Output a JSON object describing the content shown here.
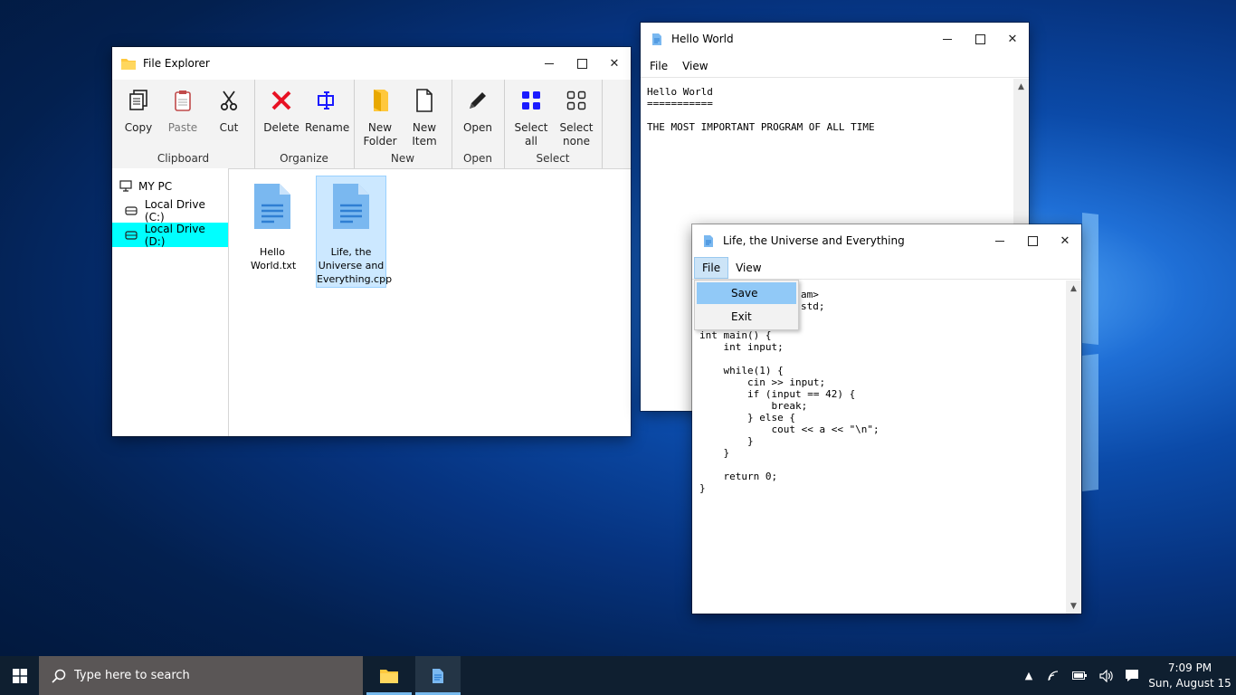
{
  "file_explorer": {
    "title": "File Explorer",
    "ribbon": {
      "groups": [
        {
          "label": "Clipboard",
          "buttons": [
            "Copy",
            "Paste",
            "Cut"
          ]
        },
        {
          "label": "Organize",
          "buttons": [
            "Delete",
            "Rename"
          ]
        },
        {
          "label": "New",
          "buttons": [
            "New Folder",
            "New Item"
          ]
        },
        {
          "label": "Open",
          "buttons": [
            "Open"
          ]
        },
        {
          "label": "Select",
          "buttons": [
            "Select all",
            "Select none"
          ]
        }
      ]
    },
    "nav": [
      "MY PC",
      "Local Drive (C:)",
      "Local Drive (D:)"
    ],
    "files": [
      "Hello World.txt",
      "Life, the Universe and Everything.cpp"
    ]
  },
  "hello_window": {
    "title": "Hello World",
    "menu": [
      "File",
      "View"
    ],
    "text": "Hello World\n===========\n\nTHE MOST IMPORTANT PROGRAM OF ALL TIME"
  },
  "life_window": {
    "title": "Life, the Universe and Everything",
    "menu": [
      "File",
      "View"
    ],
    "code_visible_fragments": [
      "am>",
      "std;"
    ],
    "code": "\nint main() {\n    int input;\n\n    while(1) {\n        cin >> input;\n        if (input == 42) {\n            break;\n        } else {\n            cout << a << \"\\n\";\n        }\n    }\n\n    return 0;\n}",
    "dropdown": [
      "Save",
      "Exit"
    ]
  },
  "taskbar": {
    "search_placeholder": "Type here to search",
    "time": "7:09 PM",
    "date": "Sun, August 15"
  },
  "colors": {
    "nav_selected": "#00ffff",
    "icon_blue": "#1a1aff",
    "delete_red": "#e81123",
    "folder_yellow": "#ffc83d",
    "file_icon_blue": "#2f7fd3"
  }
}
